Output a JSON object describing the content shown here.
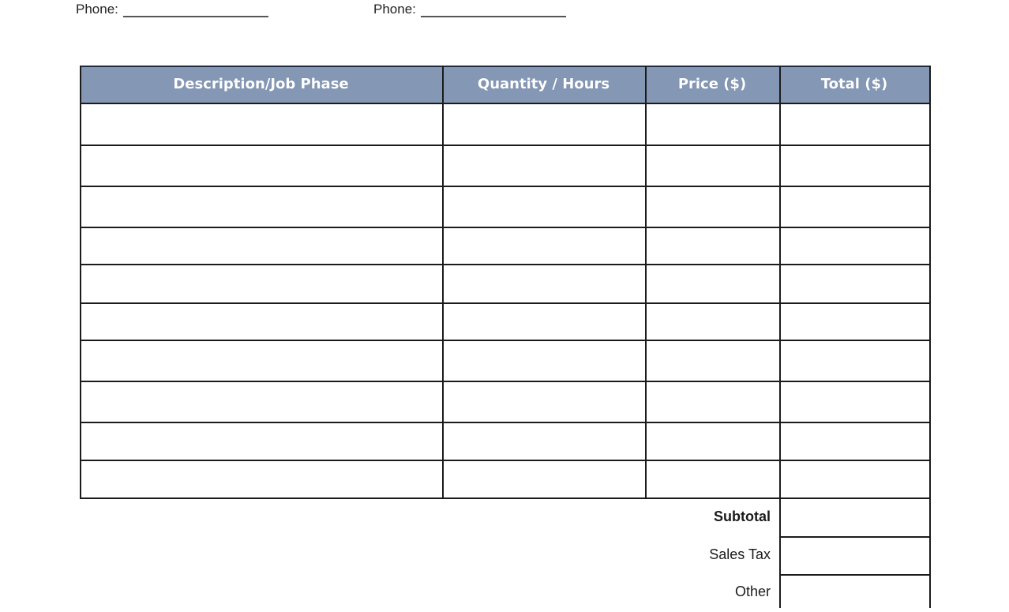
{
  "header_fields": {
    "phone_left_label": "Phone:",
    "phone_right_label": "Phone:"
  },
  "table": {
    "columns": [
      {
        "label": "Description/Job Phase"
      },
      {
        "label": "Quantity / Hours"
      },
      {
        "label": "Price ($)"
      },
      {
        "label": "Total ($)"
      }
    ],
    "header_color": "#8497b5",
    "border_color": "#1b1b1b",
    "rows": [
      [
        "",
        "",
        "",
        ""
      ],
      [
        "",
        "",
        "",
        ""
      ],
      [
        "",
        "",
        "",
        ""
      ],
      [
        "",
        "",
        "",
        ""
      ],
      [
        "",
        "",
        "",
        ""
      ],
      [
        "",
        "",
        "",
        ""
      ],
      [
        "",
        "",
        "",
        ""
      ],
      [
        "",
        "",
        "",
        ""
      ],
      [
        "",
        "",
        "",
        ""
      ],
      [
        "",
        "",
        "",
        ""
      ]
    ]
  },
  "summary": {
    "subtotal_label": "Subtotal",
    "sales_tax_label": "Sales Tax",
    "other_label": "Other",
    "subtotal_value": "",
    "sales_tax_value": "",
    "other_value": ""
  }
}
